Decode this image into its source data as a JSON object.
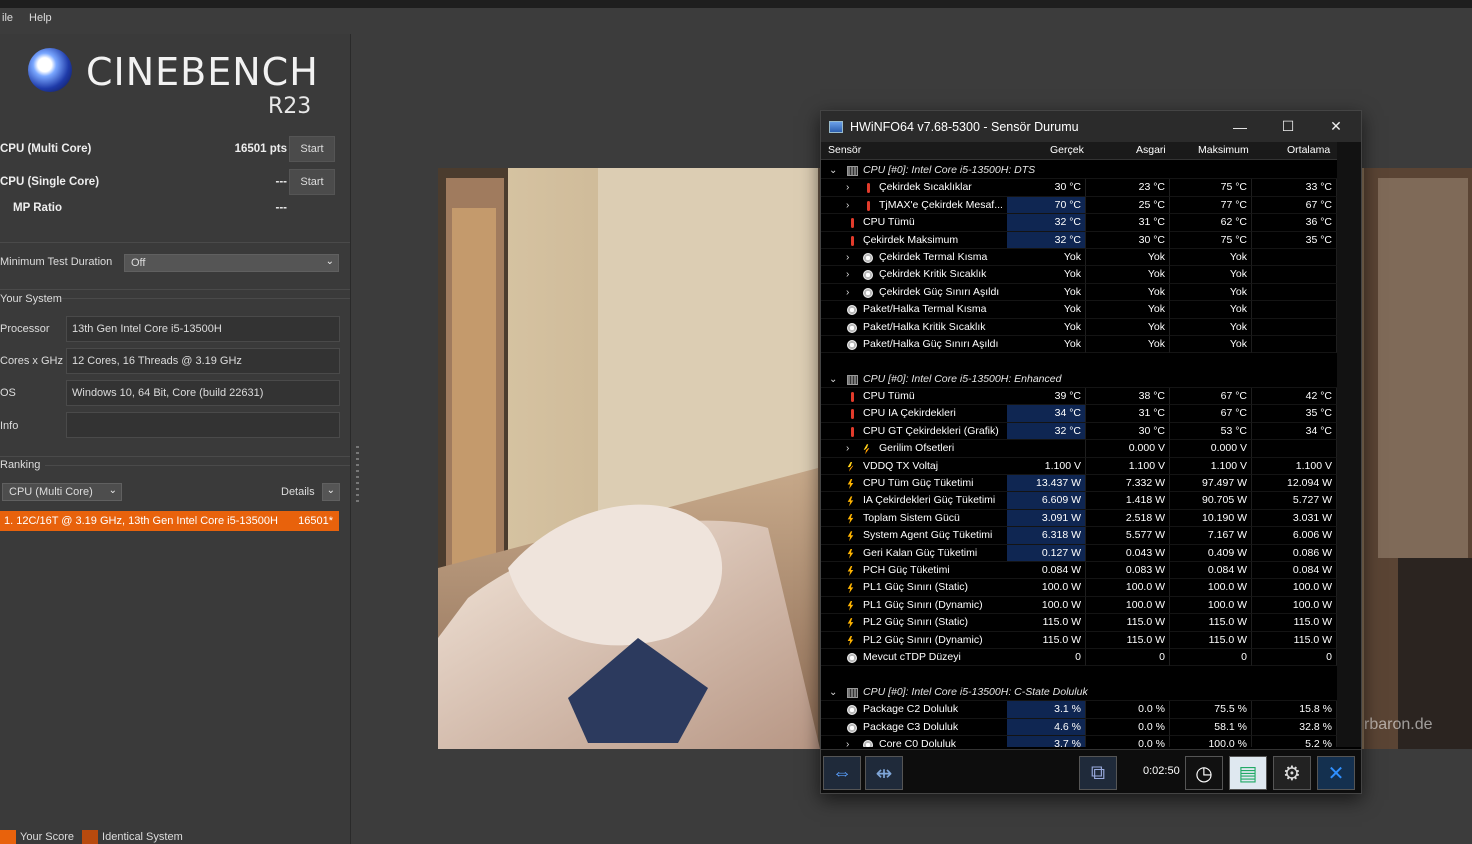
{
  "menu": [
    "ile",
    "Help"
  ],
  "cinebench": {
    "logo_name": "CINEBENCH",
    "logo_version": "R23",
    "multi_label": "CPU (Multi Core)",
    "multi_score": "16501 pts",
    "single_label": "CPU (Single Core)",
    "single_score": "---",
    "mp_label": "MP Ratio",
    "mp_value": "---",
    "start_label": "Start",
    "min_duration_label": "Minimum Test Duration",
    "min_duration_value": "Off",
    "your_system_label": "Your System",
    "system": [
      {
        "label": "Processor",
        "value": "13th Gen Intel Core i5-13500H"
      },
      {
        "label": "Cores x GHz",
        "value": "12 Cores, 16 Threads @ 3.19 GHz"
      },
      {
        "label": "OS",
        "value": "Windows 10, 64 Bit, Core (build 22631)"
      },
      {
        "label": "Info",
        "value": ""
      }
    ],
    "ranking_label": "Ranking",
    "ranking_select": "CPU (Multi Core)",
    "details_label": "Details",
    "rank_entry": "1. 12C/16T @ 3.19 GHz, 13th Gen Intel Core i5-13500H",
    "rank_score": "16501*",
    "legend": [
      {
        "label": "Your Score",
        "color": "#e8620c"
      },
      {
        "label": "Identical System",
        "color": "#b84a0e"
      }
    ]
  },
  "render": {
    "watermark": "rbaron.de"
  },
  "hwinfo": {
    "title": "HWiNFO64 v7.68-5300 - Sensör Durumu",
    "columns": [
      "Sensör",
      "Gerçek",
      "Asgari",
      "Maksimum",
      "Ortalama"
    ],
    "rows": [
      {
        "type": "group",
        "name": "CPU [#0]: Intel Core i5-13500H: DTS"
      },
      {
        "icon": "therm",
        "indent": 1,
        "exp": true,
        "name": "Çekirdek Sıcaklıklar",
        "v": [
          "30 °C",
          "23 °C",
          "75 °C",
          "33 °C"
        ]
      },
      {
        "icon": "therm",
        "indent": 1,
        "exp": true,
        "name": "TjMAX'e Çekirdek Mesaf...",
        "v": [
          "70 °C",
          "25 °C",
          "77 °C",
          "67 °C"
        ],
        "hl": true
      },
      {
        "icon": "therm",
        "indent": 0,
        "name": "CPU Tümü",
        "v": [
          "32 °C",
          "31 °C",
          "62 °C",
          "36 °C"
        ],
        "hl": true
      },
      {
        "icon": "therm",
        "indent": 0,
        "name": "Çekirdek Maksimum",
        "v": [
          "32 °C",
          "30 °C",
          "75 °C",
          "35 °C"
        ],
        "hl": true
      },
      {
        "icon": "yes",
        "indent": 1,
        "exp": true,
        "name": "Çekirdek Termal Kısma",
        "v": [
          "Yok",
          "Yok",
          "Yok",
          ""
        ]
      },
      {
        "icon": "yes",
        "indent": 1,
        "exp": true,
        "name": "Çekirdek Kritik Sıcaklık",
        "v": [
          "Yok",
          "Yok",
          "Yok",
          ""
        ]
      },
      {
        "icon": "yes",
        "indent": 1,
        "exp": true,
        "name": "Çekirdek Güç Sınırı Aşıldı",
        "v": [
          "Yok",
          "Yok",
          "Yok",
          ""
        ]
      },
      {
        "icon": "yes",
        "indent": 0,
        "name": "Paket/Halka Termal Kısma",
        "v": [
          "Yok",
          "Yok",
          "Yok",
          ""
        ]
      },
      {
        "icon": "yes",
        "indent": 0,
        "name": "Paket/Halka Kritik Sıcaklık",
        "v": [
          "Yok",
          "Yok",
          "Yok",
          ""
        ]
      },
      {
        "icon": "yes",
        "indent": 0,
        "name": "Paket/Halka Güç Sınırı Aşıldı",
        "v": [
          "Yok",
          "Yok",
          "Yok",
          ""
        ]
      },
      {
        "type": "blank"
      },
      {
        "type": "group",
        "name": "CPU [#0]: Intel Core i5-13500H: Enhanced"
      },
      {
        "icon": "therm",
        "indent": 0,
        "name": "CPU Tümü",
        "v": [
          "39 °C",
          "38 °C",
          "67 °C",
          "42 °C"
        ]
      },
      {
        "icon": "therm",
        "indent": 0,
        "name": "CPU IA Çekirdekleri",
        "v": [
          "34 °C",
          "31 °C",
          "67 °C",
          "35 °C"
        ],
        "hl": true
      },
      {
        "icon": "therm",
        "indent": 0,
        "name": "CPU GT Çekirdekleri (Grafik)",
        "v": [
          "32 °C",
          "30 °C",
          "53 °C",
          "34 °C"
        ],
        "hl": true
      },
      {
        "icon": "volt",
        "indent": 1,
        "exp": true,
        "name": "Gerilim Ofsetleri",
        "v": [
          "",
          "0.000 V",
          "0.000 V",
          ""
        ]
      },
      {
        "icon": "volt",
        "indent": 0,
        "name": "VDDQ TX Voltaj",
        "v": [
          "1.100 V",
          "1.100 V",
          "1.100 V",
          "1.100 V"
        ]
      },
      {
        "icon": "power",
        "indent": 0,
        "name": "CPU Tüm Güç Tüketimi",
        "v": [
          "13.437 W",
          "7.332 W",
          "97.497 W",
          "12.094 W"
        ],
        "hl": true
      },
      {
        "icon": "power",
        "indent": 0,
        "name": "IA Çekirdekleri Güç Tüketimi",
        "v": [
          "6.609 W",
          "1.418 W",
          "90.705 W",
          "5.727 W"
        ],
        "hl": true
      },
      {
        "icon": "power",
        "indent": 0,
        "name": "Toplam Sistem Gücü",
        "v": [
          "3.091 W",
          "2.518 W",
          "10.190 W",
          "3.031 W"
        ],
        "hl": true
      },
      {
        "icon": "power",
        "indent": 0,
        "name": "System Agent Güç Tüketimi",
        "v": [
          "6.318 W",
          "5.577 W",
          "7.167 W",
          "6.006 W"
        ],
        "hl": true
      },
      {
        "icon": "power",
        "indent": 0,
        "name": "Geri Kalan Güç Tüketimi",
        "v": [
          "0.127 W",
          "0.043 W",
          "0.409 W",
          "0.086 W"
        ],
        "hl": true
      },
      {
        "icon": "power",
        "indent": 0,
        "name": "PCH Güç Tüketimi",
        "v": [
          "0.084 W",
          "0.083 W",
          "0.084 W",
          "0.084 W"
        ]
      },
      {
        "icon": "power",
        "indent": 0,
        "name": "PL1 Güç Sınırı (Static)",
        "v": [
          "100.0 W",
          "100.0 W",
          "100.0 W",
          "100.0 W"
        ]
      },
      {
        "icon": "power",
        "indent": 0,
        "name": "PL1 Güç Sınırı (Dynamic)",
        "v": [
          "100.0 W",
          "100.0 W",
          "100.0 W",
          "100.0 W"
        ]
      },
      {
        "icon": "power",
        "indent": 0,
        "name": "PL2 Güç Sınırı (Static)",
        "v": [
          "115.0 W",
          "115.0 W",
          "115.0 W",
          "115.0 W"
        ]
      },
      {
        "icon": "power",
        "indent": 0,
        "name": "PL2 Güç Sınırı (Dynamic)",
        "v": [
          "115.0 W",
          "115.0 W",
          "115.0 W",
          "115.0 W"
        ]
      },
      {
        "icon": "yes",
        "indent": 0,
        "name": "Mevcut cTDP Düzeyi",
        "v": [
          "0",
          "0",
          "0",
          "0"
        ]
      },
      {
        "type": "blank"
      },
      {
        "type": "group",
        "name": "CPU [#0]: Intel Core i5-13500H: C-State Doluluk"
      },
      {
        "icon": "yes",
        "indent": 0,
        "name": "Package C2 Doluluk",
        "v": [
          "3.1 %",
          "0.0 %",
          "75.5 %",
          "15.8 %"
        ],
        "hl": true
      },
      {
        "icon": "yes",
        "indent": 0,
        "name": "Package C3 Doluluk",
        "v": [
          "4.6 %",
          "0.0 %",
          "58.1 %",
          "32.8 %"
        ],
        "hl": true
      },
      {
        "icon": "yes",
        "indent": 1,
        "exp": true,
        "name": "Core C0 Doluluk",
        "v": [
          "3.7 %",
          "0.0 %",
          "100.0 %",
          "5.2 %"
        ],
        "hl": true
      }
    ],
    "timer": "0:02:50"
  }
}
